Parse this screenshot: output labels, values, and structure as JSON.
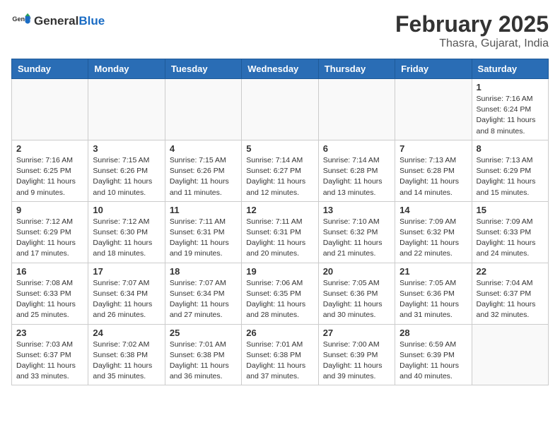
{
  "logo": {
    "general": "General",
    "blue": "Blue"
  },
  "title": "February 2025",
  "subtitle": "Thasra, Gujarat, India",
  "days_of_week": [
    "Sunday",
    "Monday",
    "Tuesday",
    "Wednesday",
    "Thursday",
    "Friday",
    "Saturday"
  ],
  "weeks": [
    [
      {
        "day": "",
        "info": ""
      },
      {
        "day": "",
        "info": ""
      },
      {
        "day": "",
        "info": ""
      },
      {
        "day": "",
        "info": ""
      },
      {
        "day": "",
        "info": ""
      },
      {
        "day": "",
        "info": ""
      },
      {
        "day": "1",
        "info": "Sunrise: 7:16 AM\nSunset: 6:24 PM\nDaylight: 11 hours and 8 minutes."
      }
    ],
    [
      {
        "day": "2",
        "info": "Sunrise: 7:16 AM\nSunset: 6:25 PM\nDaylight: 11 hours and 9 minutes."
      },
      {
        "day": "3",
        "info": "Sunrise: 7:15 AM\nSunset: 6:26 PM\nDaylight: 11 hours and 10 minutes."
      },
      {
        "day": "4",
        "info": "Sunrise: 7:15 AM\nSunset: 6:26 PM\nDaylight: 11 hours and 11 minutes."
      },
      {
        "day": "5",
        "info": "Sunrise: 7:14 AM\nSunset: 6:27 PM\nDaylight: 11 hours and 12 minutes."
      },
      {
        "day": "6",
        "info": "Sunrise: 7:14 AM\nSunset: 6:28 PM\nDaylight: 11 hours and 13 minutes."
      },
      {
        "day": "7",
        "info": "Sunrise: 7:13 AM\nSunset: 6:28 PM\nDaylight: 11 hours and 14 minutes."
      },
      {
        "day": "8",
        "info": "Sunrise: 7:13 AM\nSunset: 6:29 PM\nDaylight: 11 hours and 15 minutes."
      }
    ],
    [
      {
        "day": "9",
        "info": "Sunrise: 7:12 AM\nSunset: 6:29 PM\nDaylight: 11 hours and 17 minutes."
      },
      {
        "day": "10",
        "info": "Sunrise: 7:12 AM\nSunset: 6:30 PM\nDaylight: 11 hours and 18 minutes."
      },
      {
        "day": "11",
        "info": "Sunrise: 7:11 AM\nSunset: 6:31 PM\nDaylight: 11 hours and 19 minutes."
      },
      {
        "day": "12",
        "info": "Sunrise: 7:11 AM\nSunset: 6:31 PM\nDaylight: 11 hours and 20 minutes."
      },
      {
        "day": "13",
        "info": "Sunrise: 7:10 AM\nSunset: 6:32 PM\nDaylight: 11 hours and 21 minutes."
      },
      {
        "day": "14",
        "info": "Sunrise: 7:09 AM\nSunset: 6:32 PM\nDaylight: 11 hours and 22 minutes."
      },
      {
        "day": "15",
        "info": "Sunrise: 7:09 AM\nSunset: 6:33 PM\nDaylight: 11 hours and 24 minutes."
      }
    ],
    [
      {
        "day": "16",
        "info": "Sunrise: 7:08 AM\nSunset: 6:33 PM\nDaylight: 11 hours and 25 minutes."
      },
      {
        "day": "17",
        "info": "Sunrise: 7:07 AM\nSunset: 6:34 PM\nDaylight: 11 hours and 26 minutes."
      },
      {
        "day": "18",
        "info": "Sunrise: 7:07 AM\nSunset: 6:34 PM\nDaylight: 11 hours and 27 minutes."
      },
      {
        "day": "19",
        "info": "Sunrise: 7:06 AM\nSunset: 6:35 PM\nDaylight: 11 hours and 28 minutes."
      },
      {
        "day": "20",
        "info": "Sunrise: 7:05 AM\nSunset: 6:36 PM\nDaylight: 11 hours and 30 minutes."
      },
      {
        "day": "21",
        "info": "Sunrise: 7:05 AM\nSunset: 6:36 PM\nDaylight: 11 hours and 31 minutes."
      },
      {
        "day": "22",
        "info": "Sunrise: 7:04 AM\nSunset: 6:37 PM\nDaylight: 11 hours and 32 minutes."
      }
    ],
    [
      {
        "day": "23",
        "info": "Sunrise: 7:03 AM\nSunset: 6:37 PM\nDaylight: 11 hours and 33 minutes."
      },
      {
        "day": "24",
        "info": "Sunrise: 7:02 AM\nSunset: 6:38 PM\nDaylight: 11 hours and 35 minutes."
      },
      {
        "day": "25",
        "info": "Sunrise: 7:01 AM\nSunset: 6:38 PM\nDaylight: 11 hours and 36 minutes."
      },
      {
        "day": "26",
        "info": "Sunrise: 7:01 AM\nSunset: 6:38 PM\nDaylight: 11 hours and 37 minutes."
      },
      {
        "day": "27",
        "info": "Sunrise: 7:00 AM\nSunset: 6:39 PM\nDaylight: 11 hours and 39 minutes."
      },
      {
        "day": "28",
        "info": "Sunrise: 6:59 AM\nSunset: 6:39 PM\nDaylight: 11 hours and 40 minutes."
      },
      {
        "day": "",
        "info": ""
      }
    ]
  ]
}
